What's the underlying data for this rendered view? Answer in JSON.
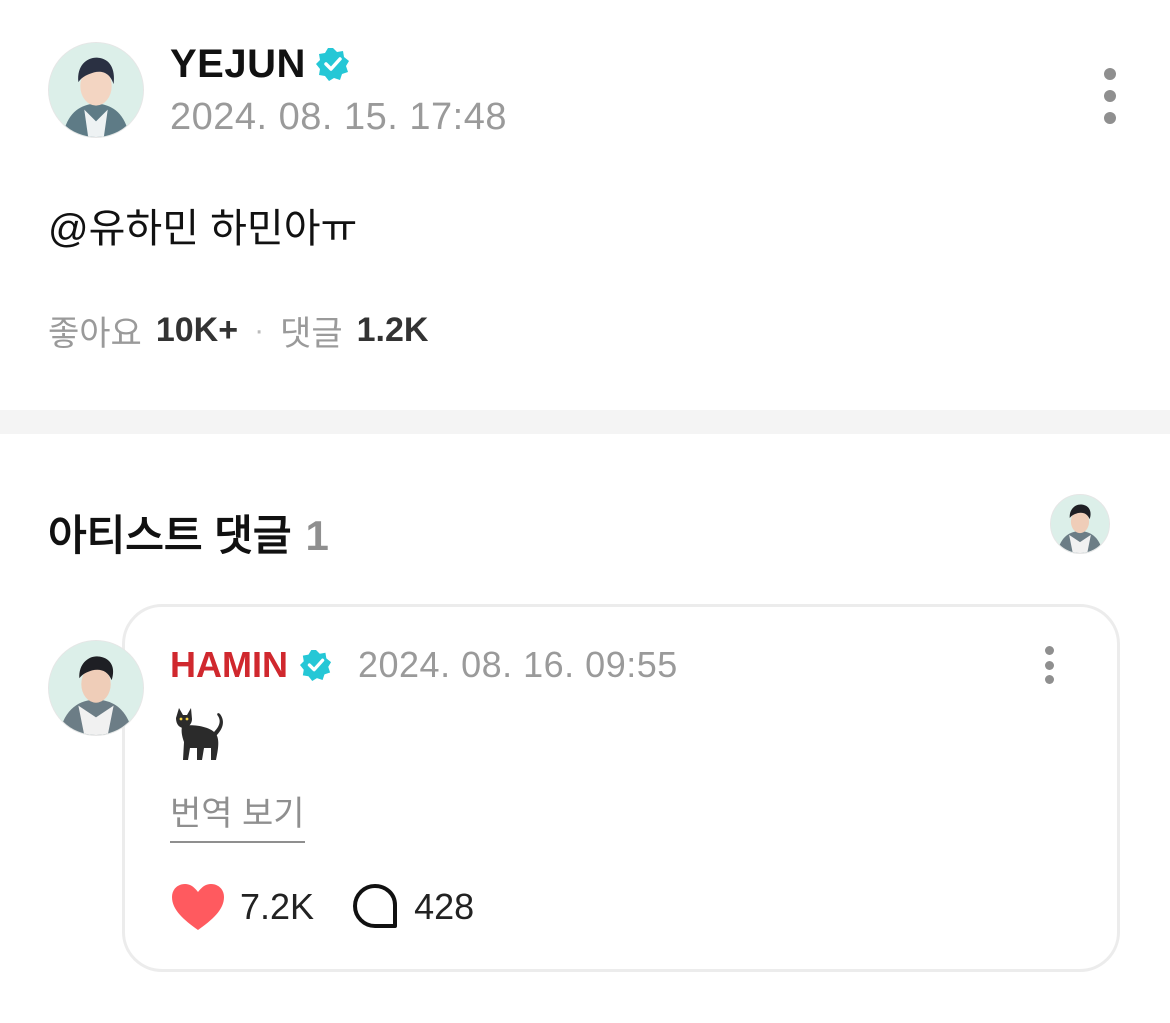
{
  "post": {
    "author": "YEJUN",
    "timestamp": "2024. 08. 15. 17:48",
    "text": "@유하민 하민아ㅠ",
    "likes_label": "좋아요",
    "likes_value": "10K+",
    "separator": "·",
    "comments_label": "댓글",
    "comments_value": "1.2K"
  },
  "artist_comments": {
    "title": "아티스트 댓글",
    "count": "1"
  },
  "comment": {
    "author": "HAMIN",
    "timestamp": "2024. 08. 16. 09:55",
    "text": "🐈‍⬛",
    "translate_label": "번역 보기",
    "likes": "7.2K",
    "replies": "428"
  },
  "colors": {
    "verified": "#25c7d6",
    "artist_name": "#d0282e",
    "heart": "#ff5a5f",
    "muted_text": "#9a9a9a"
  },
  "icons": [
    "verified-badge-icon",
    "kebab-menu-icon",
    "heart-icon",
    "comment-bubble-icon",
    "cat-emoji"
  ]
}
